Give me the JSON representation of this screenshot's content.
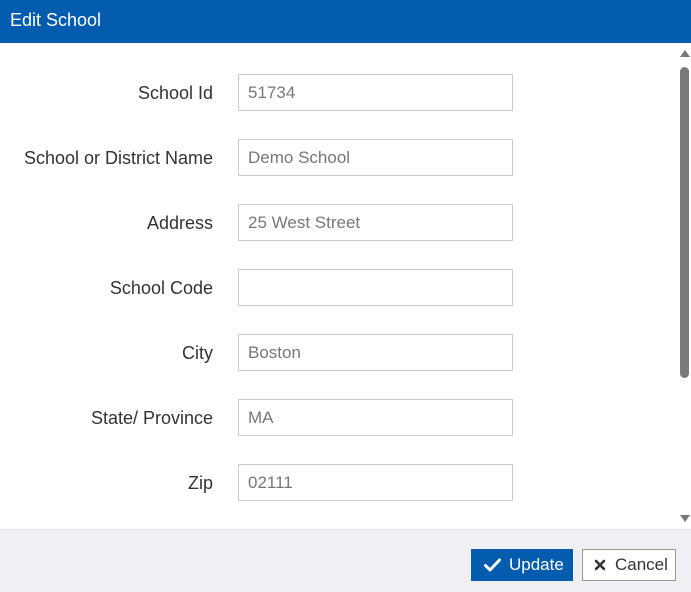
{
  "dialog": {
    "title": "Edit School"
  },
  "form": {
    "fields": [
      {
        "label": "School Id",
        "value": "51734"
      },
      {
        "label": "School or District Name",
        "value": "Demo School"
      },
      {
        "label": "Address",
        "value": "25 West Street"
      },
      {
        "label": "School Code",
        "value": ""
      },
      {
        "label": "City",
        "value": "Boston"
      },
      {
        "label": "State/ Province",
        "value": "MA"
      },
      {
        "label": "Zip",
        "value": "02111"
      }
    ]
  },
  "footer": {
    "update_label": "Update",
    "update_icon": "check-icon",
    "cancel_label": "Cancel",
    "cancel_icon": "close-icon"
  },
  "colors": {
    "accent": "#035cae",
    "footer_bg": "#eef0f4"
  }
}
